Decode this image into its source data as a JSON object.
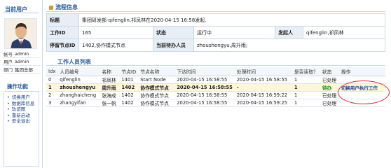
{
  "sidebar": {
    "title": "当前用户",
    "fields": [
      {
        "key": "帐号",
        "value": "admin"
      },
      {
        "key": "用户",
        "value": "admin"
      },
      {
        "key": "部门",
        "value": "集团总部"
      }
    ],
    "ops_title": "操作功能",
    "ops": [
      "切换用户",
      "数据库信息",
      "轨迹图",
      "重新启动",
      "安全退出"
    ]
  },
  "flow": {
    "section_title": "流程信息",
    "title_label": "标题",
    "title_value": "集团研发部-qifenglin,祁凤林在2020-04-15 16:58发起.",
    "workid_label": "工作ID",
    "workid_value": "165",
    "state_label": "状态",
    "state_value": "运行中",
    "starter_label": "发起人",
    "starter_value": "qifenglin,祁凤林",
    "node_label": "停留节点ID",
    "node_value": "1402,协作模式节点",
    "pending_label": "当前待办人员",
    "pending_value": "zhoushengyu,周升雨;"
  },
  "staff": {
    "section_title": "工作人员列表",
    "columns": [
      "Idx",
      "人员编号",
      "名称",
      "节点ID",
      "节点名称",
      "下达时间",
      "处理时间",
      "是否读取？",
      "状态",
      "操作"
    ],
    "rows": [
      {
        "idx": "0",
        "id": "qifenglin",
        "name": "祁凤林",
        "node": "1401",
        "node_name": "Start Node",
        "issued": "2020-04-15 16:58:55",
        "handled": "2020-04-15 16:58:55",
        "read": "1",
        "status": "已处理",
        "action": ""
      },
      {
        "idx": "1",
        "id": "zhoushengyu",
        "name": "周升雨",
        "node": "1402",
        "node_name": "协作模式节点",
        "issued": "2020-04-15 16:58:55",
        "handled": "-",
        "read": "1",
        "status": "待办",
        "action": "切换用户执行工作"
      },
      {
        "idx": "2",
        "id": "zhanghaicheng",
        "name": "张海成",
        "node": "1402",
        "node_name": "协作模式节点",
        "issued": "2020-04-15 16:58:55",
        "handled": "2020-04-15 16:59:22",
        "read": "1",
        "status": "已处理",
        "action": ""
      },
      {
        "idx": "3",
        "id": "zhangyifan",
        "name": "张一帆",
        "node": "1402",
        "node_name": "协作模式节点",
        "issued": "2020-04-15 16:58:55",
        "handled": "2020-04-15 16:59:25",
        "read": "1",
        "status": "已处理",
        "action": ""
      }
    ]
  },
  "colors": {
    "accent": "#2a5a96",
    "highlight_row": "#fbf7d8",
    "pending_status": "#1a8c1a",
    "annotation": "#e0262a"
  }
}
